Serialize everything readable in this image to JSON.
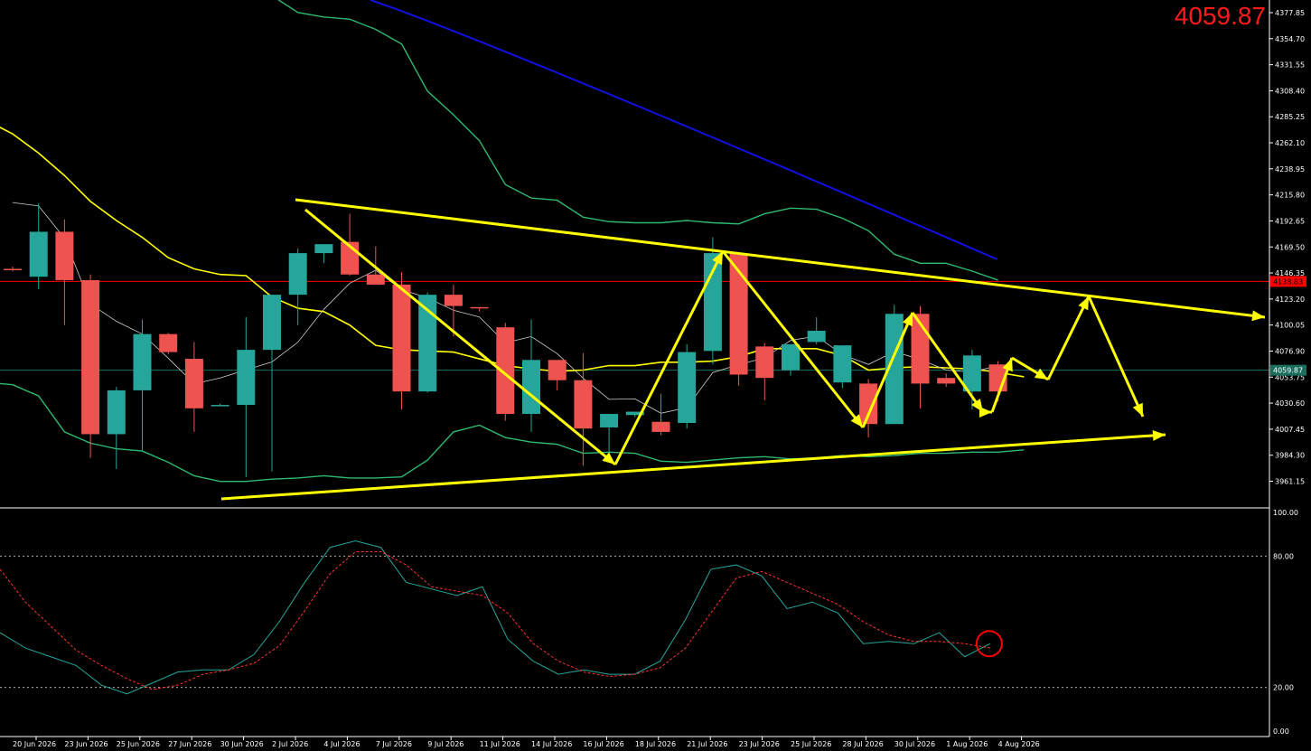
{
  "price_readout": "4059.87",
  "colors": {
    "background": "#000000",
    "bull": "#26a69a",
    "bear": "#ef5350",
    "bands": "#2fb870",
    "ma_slow": "#1010e0",
    "ma_mid": "#ffff00",
    "ma_fast": "#cccccc",
    "annotations": "#ffff00",
    "resistance_line": "#ff0000",
    "price_line": "#1b6e5e",
    "stoch_k": "#26a69a",
    "stoch_d": "#ff3030"
  },
  "chart_data": [
    {
      "type": "candlestick",
      "ylim": [
        3945,
        4395
      ],
      "y_ticks": [
        "4377.85",
        "4354.70",
        "4331.55",
        "4308.40",
        "4285.25",
        "4262.10",
        "4238.95",
        "4215.80",
        "4192.65",
        "4169.50",
        "4146.35",
        "4123.20",
        "4100.05",
        "4076.90",
        "4053.75",
        "4030.60",
        "4007.45",
        "3984.30",
        "3961.15"
      ],
      "x_ticks": [
        "20 Jun 2026",
        "23 Jun 2026",
        "25 Jun 2026",
        "27 Jun 2026",
        "30 Jun 2026",
        "2 Jul 2026",
        "4 Jul 2026",
        "7 Jul 2026",
        "9 Jul 2026",
        "11 Jul 2026",
        "14 Jul 2026",
        "16 Jul 2026",
        "18 Jul 2026",
        "21 Jul 2026",
        "23 Jul 2026",
        "25 Jul 2026",
        "28 Jul 2026",
        "30 Jul 2026",
        "1 Aug 2026",
        "4 Aug 2026"
      ],
      "price_labels": {
        "resistance": "4138.83",
        "current": "4059.87"
      },
      "resistance_level": 4138.83,
      "current_level": 4059.87,
      "candles": [
        {
          "o": 4150,
          "h": 4152,
          "l": 4148,
          "c": 4149
        },
        {
          "o": 4143,
          "h": 4208,
          "l": 4132,
          "c": 4183
        },
        {
          "o": 4183,
          "h": 4194,
          "l": 4100,
          "c": 4140
        },
        {
          "o": 4140,
          "h": 4145,
          "l": 3982,
          "c": 4003
        },
        {
          "o": 4003,
          "h": 4045,
          "l": 3972,
          "c": 4042
        },
        {
          "o": 4042,
          "h": 4105,
          "l": 3988,
          "c": 4092
        },
        {
          "o": 4092,
          "h": 4093,
          "l": 4074,
          "c": 4076
        },
        {
          "o": 4070,
          "h": 4085,
          "l": 4005,
          "c": 4026
        },
        {
          "o": 4029,
          "h": 4030,
          "l": 4028,
          "c": 4029
        },
        {
          "o": 4029,
          "h": 4107,
          "l": 3965,
          "c": 4078
        },
        {
          "o": 4078,
          "h": 4126,
          "l": 3970,
          "c": 4127
        },
        {
          "o": 4127,
          "h": 4168,
          "l": 4100,
          "c": 4164
        },
        {
          "o": 4164,
          "h": 4172,
          "l": 4155,
          "c": 4172
        },
        {
          "o": 4174,
          "h": 4199,
          "l": 4144,
          "c": 4145
        },
        {
          "o": 4145,
          "h": 4170,
          "l": 4138,
          "c": 4136
        },
        {
          "o": 4136,
          "h": 4147,
          "l": 4025,
          "c": 4041
        },
        {
          "o": 4041,
          "h": 4129,
          "l": 4040,
          "c": 4127
        },
        {
          "o": 4127,
          "h": 4136,
          "l": 4090,
          "c": 4117
        },
        {
          "o": 4116,
          "h": 4116,
          "l": 4112,
          "c": 4115
        },
        {
          "o": 4098,
          "h": 4102,
          "l": 4015,
          "c": 4021
        },
        {
          "o": 4021,
          "h": 4105,
          "l": 4005,
          "c": 4069
        },
        {
          "o": 4069,
          "h": 4066,
          "l": 4042,
          "c": 4051
        },
        {
          "o": 4051,
          "h": 4075,
          "l": 3975,
          "c": 4008
        },
        {
          "o": 4009,
          "h": 4020,
          "l": 3980,
          "c": 4021
        },
        {
          "o": 4020,
          "h": 4023,
          "l": 4018,
          "c": 4023
        },
        {
          "o": 4014,
          "h": 4039,
          "l": 4002,
          "c": 4005
        },
        {
          "o": 4013,
          "h": 4083,
          "l": 4008,
          "c": 4076
        },
        {
          "o": 4077,
          "h": 4178,
          "l": 4065,
          "c": 4164
        },
        {
          "o": 4164,
          "h": 4163,
          "l": 4046,
          "c": 4056
        },
        {
          "o": 4081,
          "h": 4084,
          "l": 4033,
          "c": 4053
        },
        {
          "o": 4060,
          "h": 4080,
          "l": 4055,
          "c": 4083
        },
        {
          "o": 4085,
          "h": 4107,
          "l": 4083,
          "c": 4095
        },
        {
          "o": 4049,
          "h": 4081,
          "l": 4044,
          "c": 4082
        },
        {
          "o": 4048,
          "h": 4052,
          "l": 4000,
          "c": 4012
        },
        {
          "o": 4012,
          "h": 4118,
          "l": 4012,
          "c": 4110
        },
        {
          "o": 4110,
          "h": 4117,
          "l": 4026,
          "c": 4048
        },
        {
          "o": 4053,
          "h": 4057,
          "l": 4045,
          "c": 4048
        },
        {
          "o": 4041,
          "h": 4078,
          "l": 4025,
          "c": 4073
        },
        {
          "o": 4065,
          "h": 4068,
          "l": 4032,
          "c": 4041
        }
      ],
      "bands_upper": [
        4395,
        4395,
        4395,
        4395,
        4395,
        4395,
        4395,
        4395,
        4395,
        4395,
        4395,
        4395,
        4395,
        4395,
        4393,
        4378,
        4374,
        4372,
        4363,
        4350,
        4308,
        4287,
        4264,
        4225,
        4213,
        4211,
        4196,
        4192,
        4191,
        4191,
        4193,
        4191,
        4190,
        4199,
        4204,
        4203,
        4195,
        4184,
        4163,
        4155,
        4155,
        4148,
        4140
      ],
      "bands_mid": [
        4295,
        4282,
        4270,
        4253,
        4233,
        4210,
        4193,
        4178,
        4160,
        4150,
        4145,
        4144,
        4125,
        4115,
        4112,
        4100,
        4082,
        4078,
        4077,
        4076,
        4070,
        4064,
        4061,
        4059,
        4060,
        4064,
        4064,
        4067,
        4067,
        4068,
        4072,
        4079,
        4079,
        4079,
        4073,
        4060,
        4062,
        4063,
        4062,
        4061,
        4058,
        4054
      ],
      "bands_lower": [
        4050,
        4049,
        4047,
        4037,
        4005,
        3995,
        3990,
        3988,
        3978,
        3966,
        3961,
        3961,
        3963,
        3964,
        3966,
        3964,
        3964,
        3965,
        3980,
        4005,
        4011,
        4000,
        3996,
        3994,
        3986,
        3987,
        3986,
        3979,
        3978,
        3980,
        3982,
        3983,
        3981,
        3982,
        3984,
        3983,
        3984,
        3986,
        3986,
        3987,
        3987,
        3989
      ]
    },
    {
      "type": "line",
      "indicator": "stochastic",
      "ylim": [
        0,
        100
      ],
      "y_ticks": [
        "100.00",
        "80.00",
        "20.00",
        "0.00"
      ],
      "levels": [
        80,
        20
      ],
      "k_values": [
        45,
        38,
        34,
        30,
        21,
        17,
        22,
        27,
        28,
        28,
        35,
        50,
        68,
        84,
        87,
        84,
        68,
        65,
        62,
        66,
        42,
        32,
        26,
        28,
        26,
        26,
        32,
        51,
        74,
        76,
        71,
        56,
        59,
        54,
        40,
        41,
        40,
        45,
        34,
        40
      ],
      "d_values": [
        74,
        59,
        48,
        37,
        30,
        24,
        19,
        21,
        26,
        28,
        31,
        39,
        55,
        72,
        82,
        82,
        76,
        66,
        64,
        62,
        54,
        40,
        32,
        27,
        25,
        26,
        29,
        38,
        54,
        70,
        73,
        68,
        63,
        58,
        50,
        44,
        41,
        41,
        40,
        38
      ],
      "marker_circle_at_index": 39
    }
  ]
}
